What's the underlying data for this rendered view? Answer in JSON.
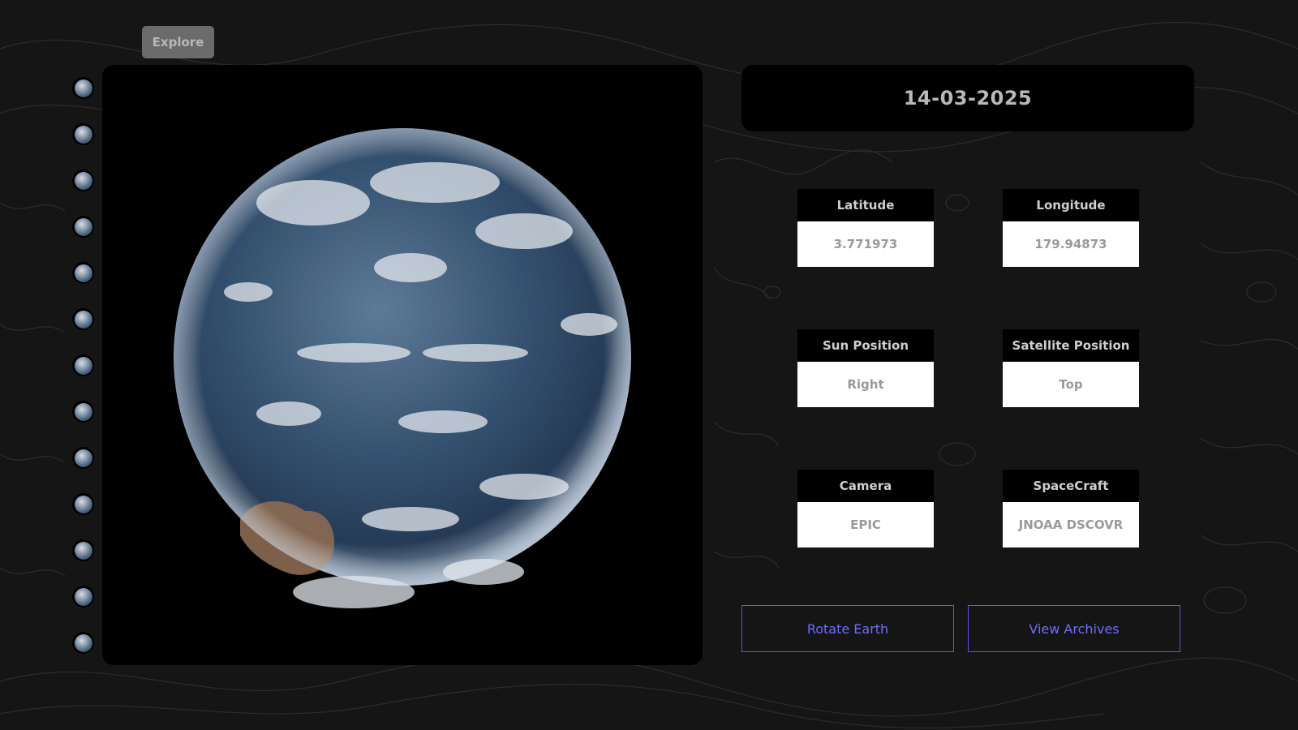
{
  "toolbar": {
    "explore_label": "Explore"
  },
  "thumbnails": {
    "count": 13,
    "icon": "earth-thumbnail-icon"
  },
  "date": "14-03-2025",
  "info": {
    "latitude": {
      "label": "Latitude",
      "value": "3.771973"
    },
    "longitude": {
      "label": "Longitude",
      "value": "179.94873"
    },
    "sun_position": {
      "label": "Sun Position",
      "value": "Right"
    },
    "satellite_position": {
      "label": "Satellite Position",
      "value": "Top"
    },
    "camera": {
      "label": "Camera",
      "value": "EPIC"
    },
    "spacecraft": {
      "label": "SpaceCraft",
      "value": "JNOAA DSCOVR"
    }
  },
  "actions": {
    "rotate_label": "Rotate Earth",
    "archives_label": "View Archives"
  },
  "colors": {
    "background": "#151515",
    "panel": "#000000",
    "accent": "#6e6cff",
    "button_gray": "#6b6b6b"
  }
}
